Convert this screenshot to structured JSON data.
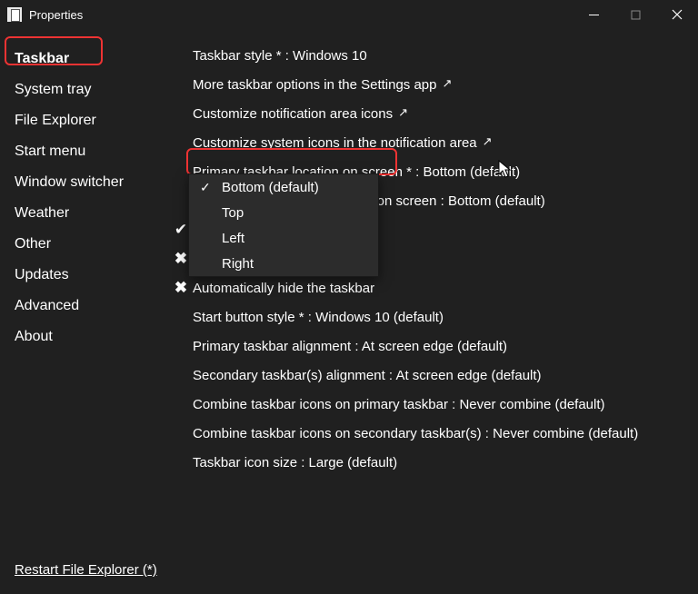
{
  "window": {
    "title": "Properties"
  },
  "sidebar": {
    "items": [
      {
        "label": "Taskbar",
        "selected": true
      },
      {
        "label": "System tray",
        "selected": false
      },
      {
        "label": "File Explorer",
        "selected": false
      },
      {
        "label": "Start menu",
        "selected": false
      },
      {
        "label": "Window switcher",
        "selected": false
      },
      {
        "label": "Weather",
        "selected": false
      },
      {
        "label": "Other",
        "selected": false
      },
      {
        "label": "Updates",
        "selected": false
      },
      {
        "label": "Advanced",
        "selected": false
      },
      {
        "label": "About",
        "selected": false
      }
    ]
  },
  "settings": {
    "rows": [
      {
        "indent": false,
        "icon": "",
        "text": "Taskbar style * : Windows 10",
        "link": false
      },
      {
        "indent": false,
        "icon": "",
        "text": "More taskbar options in the Settings app",
        "link": true
      },
      {
        "indent": false,
        "icon": "",
        "text": "Customize notification area icons",
        "link": true
      },
      {
        "indent": false,
        "icon": "",
        "text": "Customize system icons in the notification area",
        "link": true
      },
      {
        "indent": true,
        "icon": "",
        "text": "Primary taskbar location on screen * : Bottom (default)",
        "link": false,
        "highlighted": true
      },
      {
        "indent": true,
        "icon": "",
        "text": "Secondary taskbar(s) location on screen : Bottom (default)",
        "link": false
      },
      {
        "indent": false,
        "icon": "check",
        "text": "",
        "link": false
      },
      {
        "indent": false,
        "icon": "x",
        "text": "",
        "link": false
      },
      {
        "indent": false,
        "icon": "x",
        "text": "Automatically hide the taskbar",
        "link": false
      },
      {
        "indent": true,
        "icon": "",
        "text": "Start button style * : Windows 10 (default)",
        "link": false
      },
      {
        "indent": true,
        "icon": "",
        "text": "Primary taskbar alignment : At screen edge (default)",
        "link": false
      },
      {
        "indent": true,
        "icon": "",
        "text": "Secondary taskbar(s) alignment : At screen edge (default)",
        "link": false
      },
      {
        "indent": true,
        "icon": "",
        "text": "Combine taskbar icons on primary taskbar : Never combine (default)",
        "link": false
      },
      {
        "indent": true,
        "icon": "",
        "text": "Combine taskbar icons on secondary taskbar(s) : Never combine (default)",
        "link": false
      },
      {
        "indent": true,
        "icon": "",
        "text": "Taskbar icon size : Large (default)",
        "link": false
      }
    ]
  },
  "dropdown": {
    "options": [
      {
        "label": "Bottom (default)",
        "checked": true
      },
      {
        "label": "Top",
        "checked": false
      },
      {
        "label": "Left",
        "checked": false
      },
      {
        "label": "Right",
        "checked": false,
        "highlighted": true
      }
    ]
  },
  "footer": {
    "restart_link": "Restart File Explorer (*)"
  }
}
